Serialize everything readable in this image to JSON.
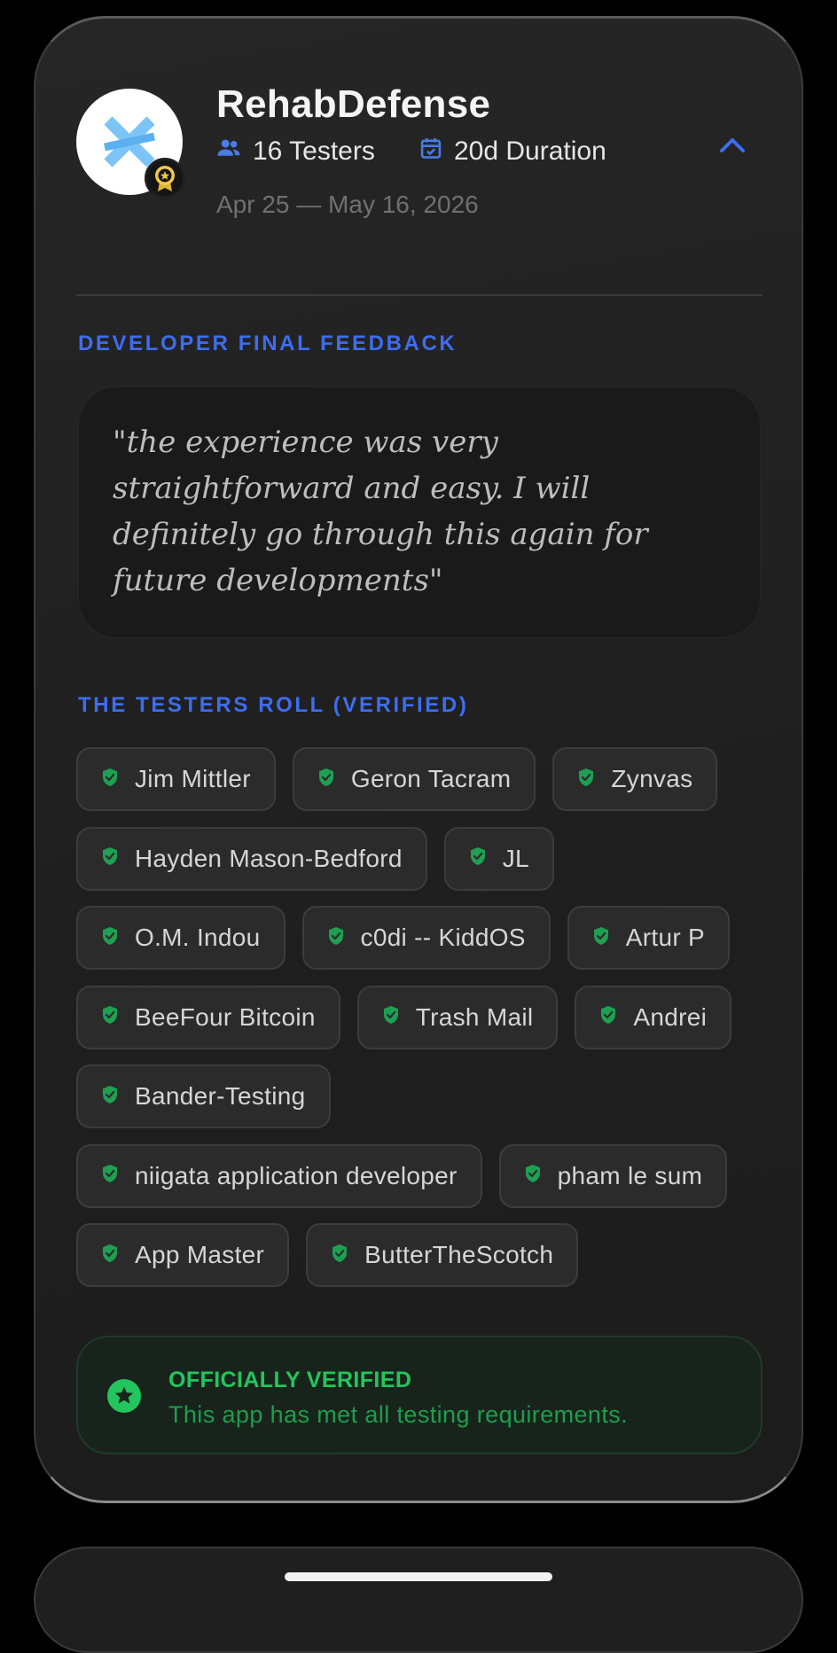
{
  "app": {
    "name": "RehabDefense",
    "testers_label": "16 Testers",
    "duration_label": "20d Duration",
    "date_range": "Apr 25 — May 16, 2026"
  },
  "feedback": {
    "section_title": "DEVELOPER FINAL FEEDBACK",
    "quote": "\"the experience was very straightforward and easy. I will definitely go through this again for future developments\""
  },
  "testers": {
    "section_title": "THE TESTERS ROLL (VERIFIED)",
    "rows": [
      [
        "Jim Mittler",
        "Geron Tacram",
        "Zynvas"
      ],
      [
        "Hayden Mason-Bedford",
        "JL"
      ],
      [
        "O.M. Indou",
        "c0di -- KiddOS",
        "Artur P"
      ],
      [
        "BeeFour Bitcoin",
        "Trash Mail",
        "Andrei"
      ],
      [
        "Bander-Testing"
      ],
      [
        "niigata application developer",
        "pham le sum"
      ],
      [
        "App Master",
        "ButterTheScotch"
      ]
    ]
  },
  "verification": {
    "title": "OFFICIALLY VERIFIED",
    "subtitle": "This app has met all testing requirements."
  },
  "icons": {
    "app_logo": "cross-x-logo-icon",
    "award": "award-badge-icon",
    "testers": "people-icon",
    "duration": "calendar-check-icon",
    "collapse": "chevron-up-icon",
    "tester_verified": "shield-check-icon",
    "official": "star-badge-icon"
  },
  "colors": {
    "accent_blue": "#3d6df0",
    "verified_green": "#22c55e",
    "card_background": "#222222",
    "logo_blue": "#7cc4f8"
  }
}
